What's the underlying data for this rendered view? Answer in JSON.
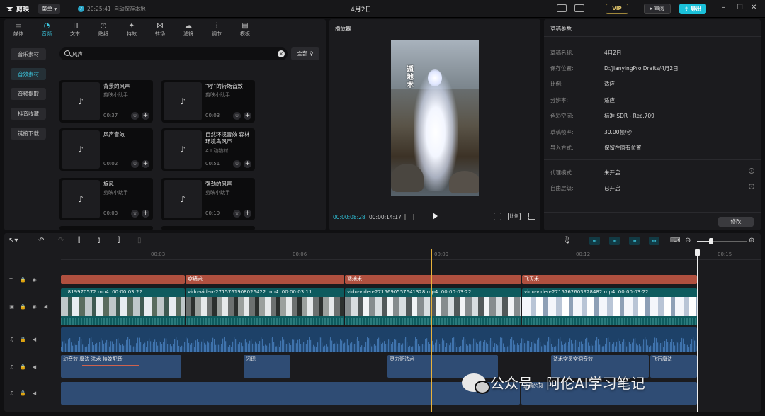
{
  "app": {
    "name": "剪映",
    "menu": "菜单",
    "save_time": "20:25:41",
    "save_status": "自动保存本地",
    "doc_title": "4月2日",
    "vip": "VIP",
    "review": "审阅",
    "export": "导出"
  },
  "tabs": [
    {
      "label": "媒体",
      "icon": "media-icon"
    },
    {
      "label": "音频",
      "icon": "audio-icon"
    },
    {
      "label": "文本",
      "icon": "text-icon"
    },
    {
      "label": "贴纸",
      "icon": "sticker-icon"
    },
    {
      "label": "特效",
      "icon": "effects-icon"
    },
    {
      "label": "转场",
      "icon": "transition-icon"
    },
    {
      "label": "滤镜",
      "icon": "filter-icon"
    },
    {
      "label": "调节",
      "icon": "adjust-icon"
    },
    {
      "label": "模板",
      "icon": "template-icon"
    }
  ],
  "active_tab": "音频",
  "side_nav": [
    "音乐素材",
    "音效素材",
    "音频提取",
    "抖音收藏",
    "链接下载"
  ],
  "active_side": "音效素材",
  "search": {
    "value": "风声"
  },
  "filter_label": "全部",
  "cards": [
    {
      "title": "背景的风声",
      "author": "剪映小助手",
      "duration": "00:37"
    },
    {
      "title": "“呼”的转场音效",
      "author": "剪映小助手",
      "duration": "00:03"
    },
    {
      "title": "风声音效",
      "author": "",
      "duration": "00:02"
    },
    {
      "title": "自然环境音效 森林环境鸟风声",
      "author": "A I 动物村",
      "duration": "00:51"
    },
    {
      "title": "旋风",
      "author": "剪映小助手",
      "duration": "00:03"
    },
    {
      "title": "强劲的风声",
      "author": "剪映小助手",
      "duration": "00:19"
    }
  ],
  "player": {
    "title": "播放器",
    "current": "00:00:08:28",
    "total": "00:00:14:17",
    "ratio": "比例",
    "caption": "遁地术"
  },
  "props": {
    "title": "草稿参数",
    "rows": [
      {
        "k": "草稿名称:",
        "v": "4月2日"
      },
      {
        "k": "保存位置:",
        "v": "D:/JianyingPro Drafts/4月2日"
      },
      {
        "k": "比例:",
        "v": "适应"
      },
      {
        "k": "分辨率:",
        "v": "适应"
      },
      {
        "k": "色彩空间:",
        "v": "标准 SDR - Rec.709"
      },
      {
        "k": "草稿帧率:",
        "v": "30.00帧/秒"
      },
      {
        "k": "导入方式:",
        "v": "保留在原有位置"
      },
      {
        "k": "代理模式:",
        "v": "未开启"
      },
      {
        "k": "自由层级:",
        "v": "已开启"
      }
    ],
    "modify": "修改"
  },
  "ruler": [
    "00:03",
    "00:06",
    "00:09",
    "00:12",
    "00:15"
  ],
  "text_clips": [
    "",
    "穿墙术",
    "遁地术",
    "飞天术"
  ],
  "video_clips": [
    {
      "name": "...819970572.mp4",
      "dur": "00:00:03:22"
    },
    {
      "name": "vidu-video-2715761908026422.mp4",
      "dur": "00:00:03:11"
    },
    {
      "name": "vidu-video-2715690557641328.mp4",
      "dur": "00:00:03:22"
    },
    {
      "name": "vidu-video-2715762603928482.mp4",
      "dur": "00:00:03:22"
    }
  ],
  "audio_clips": [
    "幻音效 魔法 法术 特效配音",
    "闪现",
    "灵力粥法术",
    "法术空灵空洞音效",
    "飞行魔法"
  ],
  "audio_clip_last": "动感的风",
  "watermark": "公众号 · 阿伦AI学习笔记"
}
